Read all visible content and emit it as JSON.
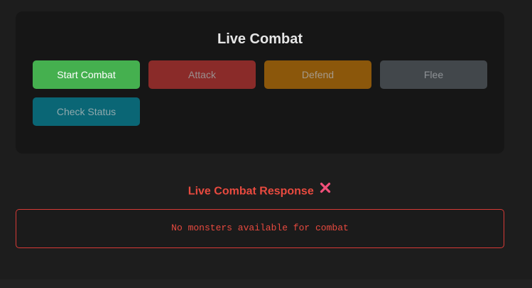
{
  "panel": {
    "title": "Live Combat",
    "buttons": {
      "start": "Start Combat",
      "attack": "Attack",
      "defend": "Defend",
      "flee": "Flee",
      "check": "Check Status"
    }
  },
  "response": {
    "title": "Live Combat Response",
    "status_icon": "cross-mark-icon",
    "message": "No monsters available for combat"
  },
  "colors": {
    "start_button": "#45b04f",
    "attack_button": "#8a2b29",
    "defend_button": "#8b570b",
    "flee_button": "#42474b",
    "check_button": "#0a6675",
    "error": "#e84a3f"
  }
}
